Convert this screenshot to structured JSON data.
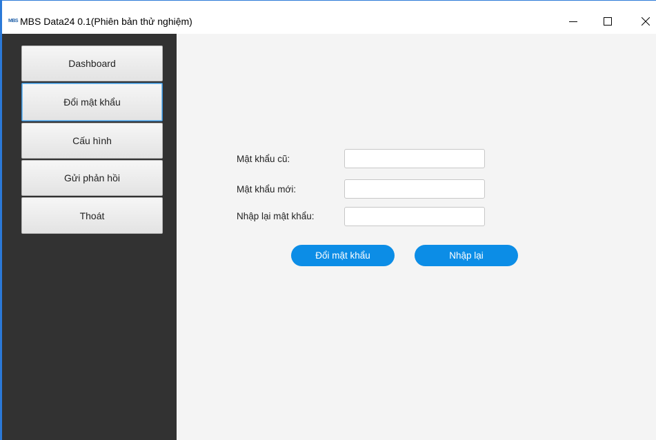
{
  "window": {
    "app_logo_text": "MBS",
    "title": "MBS Data24 0.1(Phiên bản thử nghiệm)"
  },
  "sidebar": {
    "items": [
      {
        "label": "Dashboard",
        "active": false
      },
      {
        "label": "Đổi mật khẩu",
        "active": true
      },
      {
        "label": "Cấu hình",
        "active": false
      },
      {
        "label": "Gửi phản hồi",
        "active": false
      },
      {
        "label": "Thoát",
        "active": false
      }
    ]
  },
  "form": {
    "old_password_label": "Mật khẩu cũ:",
    "old_password_value": "",
    "new_password_label": "Mật khẩu mới:",
    "new_password_value": "",
    "confirm_password_label": "Nhập lại mật khẩu:",
    "confirm_password_value": "",
    "submit_label": "Đổi mật khẩu",
    "reset_label": "Nhập lại"
  },
  "colors": {
    "window_border": "#2b79d8",
    "sidebar_bg": "#323232",
    "content_bg": "#f4f4f4",
    "button_accent": "#0c8de6",
    "active_nav_border": "#3c8fd6"
  },
  "icons": {
    "minimize": "minimize-icon",
    "maximize": "maximize-icon",
    "close": "close-icon"
  }
}
